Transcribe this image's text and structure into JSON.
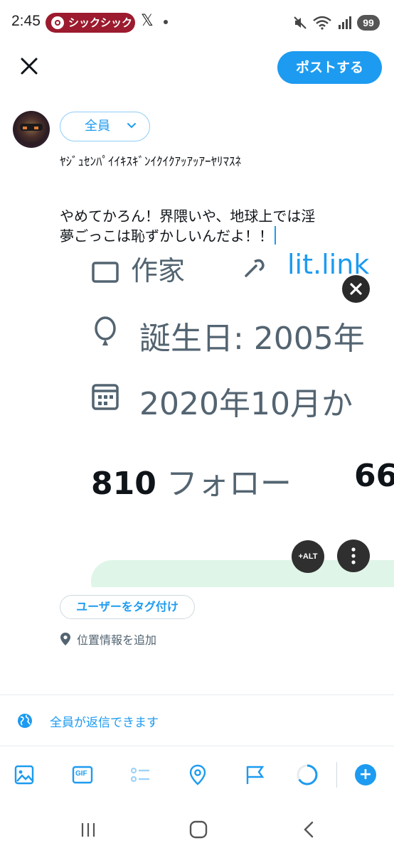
{
  "status_bar": {
    "time": "2:45",
    "notification_label": "シックシック",
    "x_logo": "𝕏",
    "battery": "99",
    "icons": [
      "target-icon",
      "x-logo-icon",
      "mute-icon",
      "wifi-icon",
      "signal-icon"
    ]
  },
  "header": {
    "close_icon": "close-icon",
    "post_label": "ポストする"
  },
  "composer": {
    "audience_label": "全員",
    "line1": "ﾔｼﾞｭｾﾝﾊﾟｲｲｷｽｷﾞﾝｲｸｲｸｱｯｱｯｱｰﾔﾘﾏｽﾈ",
    "line2": "やめてかろん！界隈いや、地球上では淫",
    "line3": "夢ごっこは恥ずかしいんだよ！！"
  },
  "attached_image": {
    "row1_text": "作家",
    "row1_link": "lit.link",
    "birthday": "誕生日: 2005年",
    "joined": "2020年10月か",
    "following_count": "810",
    "following_label": "フォロー",
    "followers_count_partial": "66",
    "alt_label": "+ALT"
  },
  "tagging": {
    "tag_users_label": "ユーザーをタグ付け",
    "location_label": "位置情報を追加"
  },
  "reply_settings": {
    "label": "全員が返信できます"
  },
  "toolbar": {
    "items": [
      "image-icon",
      "gif-icon",
      "poll-icon",
      "location-icon",
      "flag-icon",
      "progress-ring-icon",
      "add-icon"
    ],
    "gif_label": "GIF",
    "add_label": "+"
  },
  "colors": {
    "accent": "#1d9bf0",
    "notification_pill": "#9c1b2e",
    "text_secondary": "#536471"
  }
}
